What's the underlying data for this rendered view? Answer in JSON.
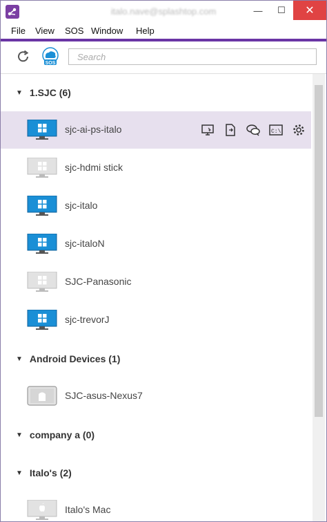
{
  "window": {
    "title_text": "italo.nave@splashtop.com",
    "min_glyph": "—",
    "max_glyph": "☐",
    "close_glyph": "✕"
  },
  "menu": {
    "items": [
      "File",
      "View",
      "SOS",
      "Window",
      "Help"
    ]
  },
  "toolbar": {
    "search_placeholder": "Search",
    "sos_label": "SOS"
  },
  "groups": [
    {
      "name": "1.SJC (6)",
      "devices": [
        {
          "name": "sjc-ai-ps-italo",
          "os": "windows",
          "online": true,
          "selected": true
        },
        {
          "name": "sjc-hdmi stick",
          "os": "windows",
          "online": false
        },
        {
          "name": "sjc-italo",
          "os": "windows",
          "online": true
        },
        {
          "name": "sjc-italoN",
          "os": "windows",
          "online": true
        },
        {
          "name": "SJC-Panasonic",
          "os": "windows",
          "online": false
        },
        {
          "name": "sjc-trevorJ",
          "os": "windows",
          "online": true
        }
      ]
    },
    {
      "name": "Android Devices (1)",
      "devices": [
        {
          "name": "SJC-asus-Nexus7",
          "os": "android",
          "online": false
        }
      ]
    },
    {
      "name": "company a (0)",
      "devices": []
    },
    {
      "name": "Italo's (2)",
      "devices": [
        {
          "name": "Italo's Mac",
          "os": "mac",
          "online": false
        }
      ]
    }
  ],
  "row_actions": [
    "remote-desktop-icon",
    "file-transfer-icon",
    "chat-icon",
    "command-prompt-icon",
    "settings-gear-icon"
  ],
  "colors": {
    "accent": "#6a35a5",
    "selected_row": "#e7e0ee",
    "online_monitor": "#1a8fd6",
    "offline_monitor": "#c8c8c8"
  }
}
